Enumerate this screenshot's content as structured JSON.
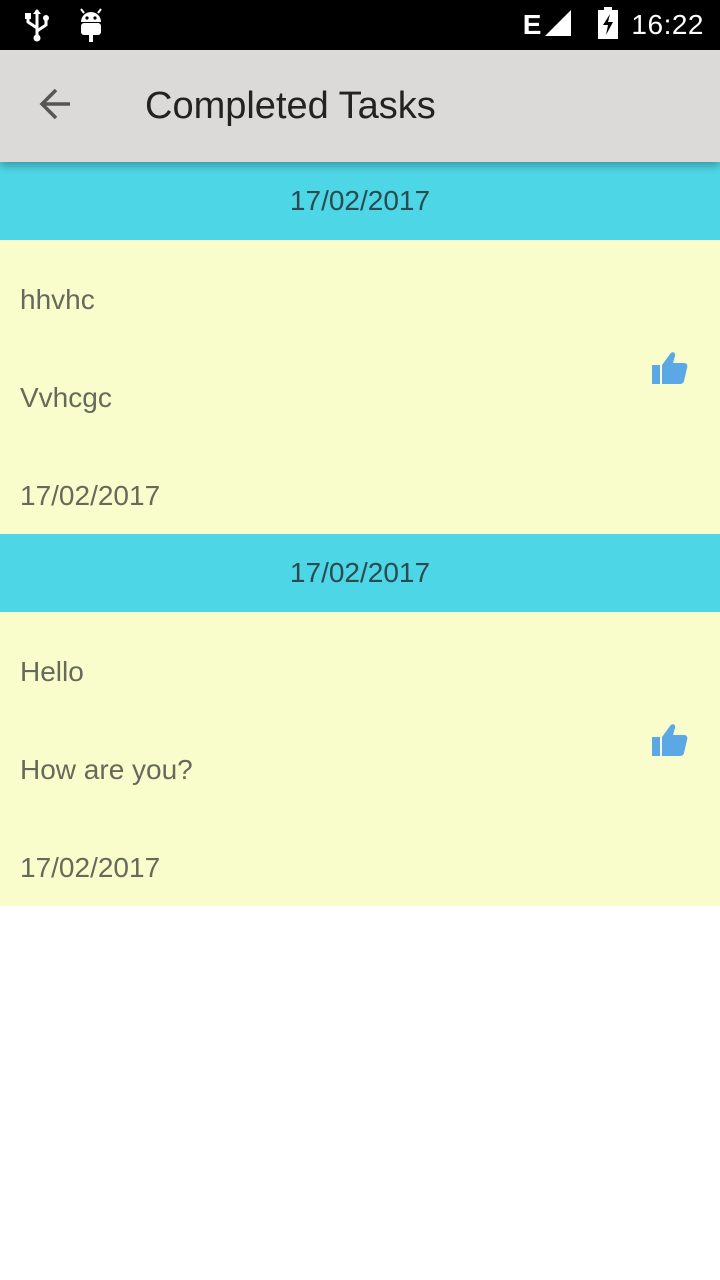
{
  "status_bar": {
    "time": "16:22",
    "network_type": "E",
    "icons": [
      "usb-icon",
      "android-debug-icon",
      "signal-icon",
      "battery-charging-icon"
    ]
  },
  "app_bar": {
    "title": "Completed Tasks",
    "back_icon": "arrow-back-icon"
  },
  "colors": {
    "app_bar_bg": "#dcd9d9",
    "section_header_bg": "#4dd6e6",
    "card_bg": "#f9fdcc",
    "thumb_icon": "#5aa9e6"
  },
  "sections": [
    {
      "header_date": "17/02/2017",
      "task": {
        "title": "hhvhc",
        "description": "Vvhcgc",
        "date": "17/02/2017",
        "status_icon": "thumbs-up-icon"
      }
    },
    {
      "header_date": "17/02/2017",
      "task": {
        "title": "Hello",
        "description": "How are you?",
        "date": "17/02/2017",
        "status_icon": "thumbs-up-icon"
      }
    }
  ]
}
